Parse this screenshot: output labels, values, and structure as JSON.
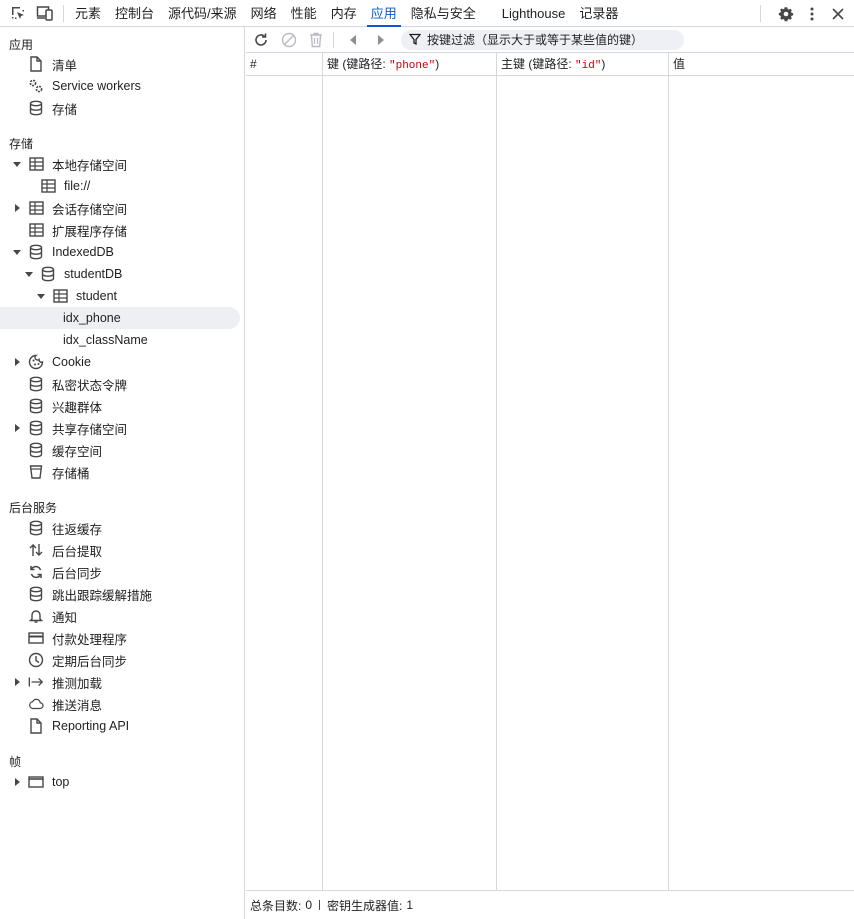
{
  "topbar": {
    "tabs": [
      {
        "label": "元素"
      },
      {
        "label": "控制台"
      },
      {
        "label": "源代码/来源"
      },
      {
        "label": "网络"
      },
      {
        "label": "性能"
      },
      {
        "label": "内存"
      },
      {
        "label": "应用",
        "active": true
      },
      {
        "label": "隐私与安全"
      },
      {
        "label": "Lighthouse"
      },
      {
        "label": "记录器"
      }
    ],
    "icons": [
      "inspect-element-icon",
      "device-toggle-icon",
      "settings-gear-icon",
      "more-vertical-icon",
      "close-icon"
    ]
  },
  "sidebar": {
    "sections": {
      "application": "应用",
      "storage": "存储",
      "background_services": "后台服务",
      "frames": "帧"
    },
    "application_items": [
      {
        "label": "清单",
        "icon": "document-icon"
      },
      {
        "label": "Service workers",
        "icon": "gears-icon"
      },
      {
        "label": "存储",
        "icon": "database-icon"
      }
    ],
    "storage_items": [
      {
        "label": "本地存储空间",
        "icon": "table-icon",
        "expanded": true
      },
      {
        "label": "file://",
        "icon": "table-icon"
      },
      {
        "label": "会话存储空间",
        "icon": "table-icon",
        "expanded": false
      },
      {
        "label": "扩展程序存储",
        "icon": "table-icon"
      },
      {
        "label": "IndexedDB",
        "icon": "database-icon",
        "expanded": true
      },
      {
        "label": "studentDB",
        "icon": "database-icon",
        "expanded": true
      },
      {
        "label": "student",
        "icon": "table-icon",
        "expanded": true
      },
      {
        "label": "idx_phone",
        "selected": true
      },
      {
        "label": "idx_className"
      },
      {
        "label": "Cookie",
        "icon": "cookie-icon",
        "expanded": false
      },
      {
        "label": "私密状态令牌",
        "icon": "database-icon"
      },
      {
        "label": "兴趣群体",
        "icon": "database-icon"
      },
      {
        "label": "共享存储空间",
        "icon": "database-icon",
        "expanded": false
      },
      {
        "label": "缓存空间",
        "icon": "database-icon"
      },
      {
        "label": "存储桶",
        "icon": "bucket-icon"
      }
    ],
    "background_items": [
      {
        "label": "往返缓存",
        "icon": "database-icon"
      },
      {
        "label": "后台提取",
        "icon": "up-down-arrows-icon"
      },
      {
        "label": "后台同步",
        "icon": "sync-icon"
      },
      {
        "label": "跳出跟踪缓解措施",
        "icon": "database-icon"
      },
      {
        "label": "通知",
        "icon": "bell-icon"
      },
      {
        "label": "付款处理程序",
        "icon": "credit-card-icon"
      },
      {
        "label": "定期后台同步",
        "icon": "clock-icon"
      },
      {
        "label": "推测加载",
        "icon": "arrow-right-bar-icon",
        "expanded": false
      },
      {
        "label": "推送消息",
        "icon": "cloud-icon"
      },
      {
        "label": "Reporting API",
        "icon": "document-icon"
      }
    ],
    "frame_items": [
      {
        "label": "top",
        "icon": "frame-window-icon",
        "expanded": false
      }
    ]
  },
  "toolbar": {
    "filter_placeholder": "按键过滤（显示大于或等于某些值的键）",
    "icons": [
      "refresh-icon",
      "clear-icon",
      "delete-icon",
      "previous-page-icon",
      "next-page-icon",
      "filter-icon"
    ]
  },
  "grid": {
    "headers": {
      "index": "#",
      "key_prefix": "键 (键路径: ",
      "key_path": "\"phone\"",
      "key_suffix": ")",
      "primary_prefix": "主键 (键路径: ",
      "primary_path": "\"id\"",
      "primary_suffix": ")",
      "value": "值"
    },
    "rows": []
  },
  "statusbar": {
    "total_label": "总条目数:",
    "total_value": "0",
    "keygen_label": "密钥生成器值:",
    "keygen_value": "1"
  },
  "colors": {
    "accent": "#0b57d0",
    "keypath": "#c80000",
    "border": "#d3d8e0",
    "selected_bg": "#eeeff2"
  }
}
